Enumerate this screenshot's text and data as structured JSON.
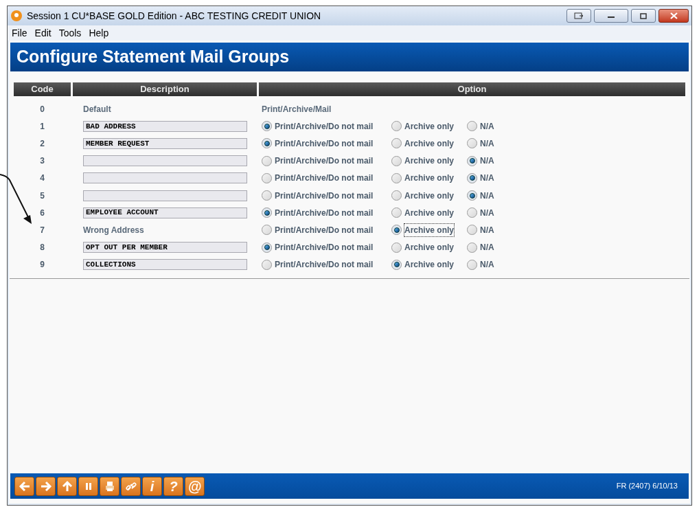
{
  "window": {
    "title": "Session 1 CU*BASE GOLD Edition - ABC TESTING CREDIT UNION"
  },
  "menu": [
    "File",
    "Edit",
    "Tools",
    "Help"
  ],
  "page_title": "Configure Statement Mail Groups",
  "table": {
    "columns": [
      "Code",
      "Description",
      "Option"
    ],
    "rows": [
      {
        "code": "0",
        "description": {
          "kind": "text",
          "value": "Default"
        },
        "option_text": "Print/Archive/Mail"
      },
      {
        "code": "1",
        "description": {
          "kind": "field",
          "value": "BAD ADDRESS"
        },
        "options": [
          {
            "label": "Print/Archive/Do not mail",
            "selected": true,
            "focused": false
          },
          {
            "label": "Archive only",
            "selected": false,
            "focused": false
          },
          {
            "label": "N/A",
            "selected": false,
            "focused": false
          }
        ]
      },
      {
        "code": "2",
        "description": {
          "kind": "field",
          "value": "MEMBER REQUEST"
        },
        "options": [
          {
            "label": "Print/Archive/Do not mail",
            "selected": true,
            "focused": false
          },
          {
            "label": "Archive only",
            "selected": false,
            "focused": false
          },
          {
            "label": "N/A",
            "selected": false,
            "focused": false
          }
        ]
      },
      {
        "code": "3",
        "description": {
          "kind": "field"
        },
        "options": [
          {
            "label": "Print/Archive/Do not mail",
            "selected": false,
            "focused": false
          },
          {
            "label": "Archive only",
            "selected": false,
            "focused": false
          },
          {
            "label": "N/A",
            "selected": true,
            "focused": false
          }
        ]
      },
      {
        "code": "4",
        "description": {
          "kind": "field"
        },
        "options": [
          {
            "label": "Print/Archive/Do not mail",
            "selected": false,
            "focused": false
          },
          {
            "label": "Archive only",
            "selected": false,
            "focused": false
          },
          {
            "label": "N/A",
            "selected": true,
            "focused": false
          }
        ]
      },
      {
        "code": "5",
        "description": {
          "kind": "field"
        },
        "options": [
          {
            "label": "Print/Archive/Do not mail",
            "selected": false,
            "focused": false
          },
          {
            "label": "Archive only",
            "selected": false,
            "focused": false
          },
          {
            "label": "N/A",
            "selected": true,
            "focused": false
          }
        ]
      },
      {
        "code": "6",
        "description": {
          "kind": "field",
          "value": "EMPLOYEE ACCOUNT"
        },
        "options": [
          {
            "label": "Print/Archive/Do not mail",
            "selected": true,
            "focused": false
          },
          {
            "label": "Archive only",
            "selected": false,
            "focused": false
          },
          {
            "label": "N/A",
            "selected": false,
            "focused": false
          }
        ]
      },
      {
        "code": "7",
        "description": {
          "kind": "text",
          "value": "Wrong Address"
        },
        "options": [
          {
            "label": "Print/Archive/Do not mail",
            "selected": false,
            "focused": false
          },
          {
            "label": "Archive only",
            "selected": true,
            "focused": true
          },
          {
            "label": "N/A",
            "selected": false,
            "focused": false
          }
        ]
      },
      {
        "code": "8",
        "description": {
          "kind": "field",
          "value": "OPT OUT PER MEMBER"
        },
        "options": [
          {
            "label": "Print/Archive/Do not mail",
            "selected": true,
            "focused": false
          },
          {
            "label": "Archive only",
            "selected": false,
            "focused": false
          },
          {
            "label": "N/A",
            "selected": false,
            "focused": false
          }
        ]
      },
      {
        "code": "9",
        "description": {
          "kind": "field",
          "value": "COLLECTIONS"
        },
        "options": [
          {
            "label": "Print/Archive/Do not mail",
            "selected": false,
            "focused": false
          },
          {
            "label": "Archive only",
            "selected": true,
            "focused": false
          },
          {
            "label": "N/A",
            "selected": false,
            "focused": false
          }
        ]
      }
    ]
  },
  "toolbar": [
    {
      "kind": "back"
    },
    {
      "kind": "forward"
    },
    {
      "kind": "up"
    },
    {
      "kind": "pause"
    },
    {
      "kind": "print"
    },
    {
      "kind": "link"
    },
    {
      "kind": "glyph",
      "text": "i"
    },
    {
      "kind": "glyph",
      "text": "?"
    },
    {
      "kind": "glyph",
      "text": "@"
    }
  ],
  "status": "FR (2407) 6/10/13"
}
